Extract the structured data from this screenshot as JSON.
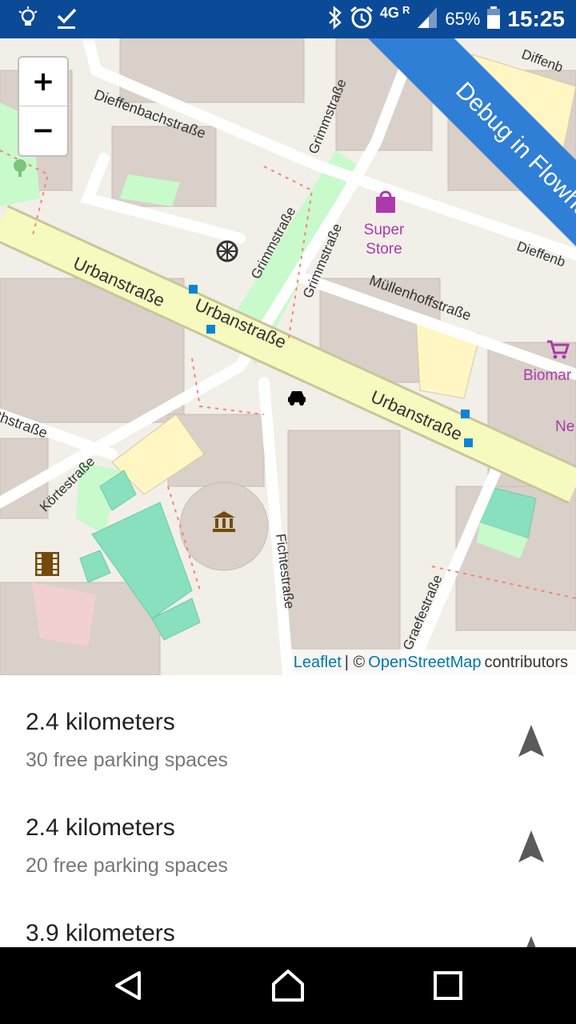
{
  "status_bar": {
    "network": "4G",
    "network_suffix": "R",
    "battery": "65%",
    "time": "15:25",
    "icons": [
      "bulb-icon",
      "check-icon",
      "bluetooth-icon",
      "alarm-icon",
      "signal-icon",
      "battery-icon"
    ]
  },
  "map": {
    "zoom_in": "+",
    "zoom_out": "−",
    "ribbon": "Debug in Flowhub",
    "streets": [
      "Dieffenbachstraße",
      "Grimmstraße",
      "Grimmstraße",
      "Grimmstraße",
      "Urbanstraße",
      "Urbanstraße",
      "Urbanstraße",
      "Müllenhoffstraße",
      "Körtestraße",
      "Fichtestraße",
      "Graefestraße",
      "thstraße",
      "Diffenb",
      "Dieffenb"
    ],
    "pois": {
      "super_store": "Super Store",
      "biomarkt": "Biomar",
      "ne": "Ne"
    },
    "attribution": {
      "leaflet": "Leaflet",
      "separator": "| ©",
      "osm": "OpenStreetMap",
      "contributors": "contributors"
    }
  },
  "results": [
    {
      "distance": "2.4 kilometers",
      "free": "30 free parking spaces"
    },
    {
      "distance": "2.4 kilometers",
      "free": "20 free parking spaces"
    },
    {
      "distance": "3.9 kilometers",
      "free": ""
    }
  ],
  "colors": {
    "status_bar": "#0b4a97",
    "ribbon": "#2f7fd6",
    "building": "#d9d0c9",
    "park": "#c8facc",
    "primary_road": "#f7fabf",
    "pitch": "#88e0be",
    "link": "#0078a8"
  }
}
